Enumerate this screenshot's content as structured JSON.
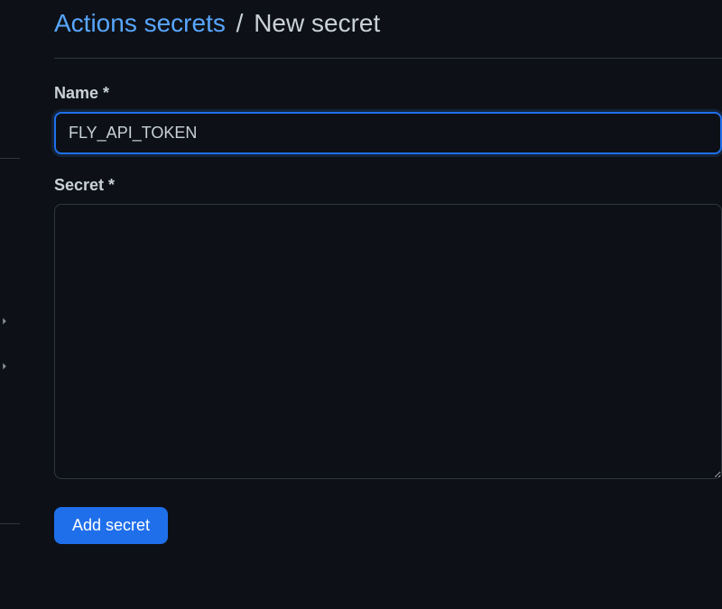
{
  "breadcrumb": {
    "parent": "Actions secrets",
    "separator": "/",
    "current": "New secret"
  },
  "form": {
    "name_label": "Name *",
    "name_value": "FLY_API_TOKEN",
    "secret_label": "Secret *",
    "secret_value": "",
    "submit_label": "Add secret"
  }
}
